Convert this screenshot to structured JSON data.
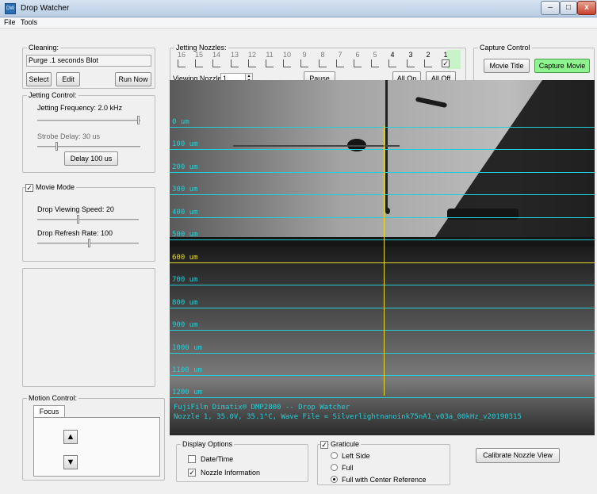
{
  "window": {
    "title": "Drop Watcher",
    "app_icon_text": "DW",
    "controls": {
      "minimize": "–",
      "maximize": "□",
      "close": "x"
    }
  },
  "menu": [
    "File",
    "Tools"
  ],
  "cleaning": {
    "label": "Cleaning:",
    "value": "Purge .1 seconds Blot",
    "buttons": {
      "select": "Select",
      "edit": "Edit",
      "run_now": "Run Now"
    }
  },
  "nozzles": {
    "label": "Jetting Nozzles:",
    "numbers": [
      "16",
      "15",
      "14",
      "13",
      "12",
      "11",
      "10",
      "9",
      "8",
      "7",
      "6",
      "5",
      "4",
      "3",
      "2",
      "1"
    ],
    "checked": [
      false,
      false,
      false,
      false,
      false,
      false,
      false,
      false,
      false,
      false,
      false,
      false,
      false,
      false,
      false,
      true
    ],
    "viewing_label": "Viewing Nozzle:",
    "viewing_value": "1",
    "pause": "Pause",
    "all_on": "All On",
    "all_off": "All Off"
  },
  "capture": {
    "label": "Capture Control",
    "movie_title": "Movie Title",
    "capture_movie": "Capture Movie"
  },
  "jetting": {
    "label": "Jetting Control:",
    "frequency_label": "Jetting Frequency:  2.0 kHz",
    "frequency_level": 1.0,
    "strobe_label": "Strobe Delay:  30 us",
    "strobe_level": 0.18,
    "delay_button": "Delay 100 us"
  },
  "movie_mode": {
    "label": "Movie Mode",
    "checked": "✓",
    "speed_label": "Drop Viewing Speed:  20",
    "speed_level": 0.4,
    "refresh_label": "Drop Refresh Rate:  100",
    "refresh_level": 0.52
  },
  "motion": {
    "label": "Motion Control:",
    "tab": "Focus",
    "up": "▲",
    "down": "▼"
  },
  "camera": {
    "graticule": [
      "0 um",
      "100 um",
      "200 um",
      "300 um",
      "400 um",
      "500 um",
      "600 um",
      "700 um",
      "800 um",
      "900 um",
      "1000 um",
      "1100 um",
      "1200 um"
    ],
    "reference_index": 6,
    "info_line1": "FujiFilm Dimatix® DMP2800 -- Drop Watcher",
    "info_line2": "Nozzle 1, 35.0V, 35.1°C, Wave File = Silverlightnanoink75nA1_v03a_00kHz_v20190315"
  },
  "display_options": {
    "label": "Display Options",
    "date_time": "Date/Time",
    "date_time_checked": "",
    "nozzle_info": "Nozzle Information",
    "nozzle_info_checked": "✓"
  },
  "graticule_opts": {
    "label": "Graticule",
    "checked": "✓",
    "left_side": "Left Side",
    "full": "Full",
    "full_center": "Full with Center Reference",
    "selected": "full_center"
  },
  "calibrate": "Calibrate Nozzle View"
}
